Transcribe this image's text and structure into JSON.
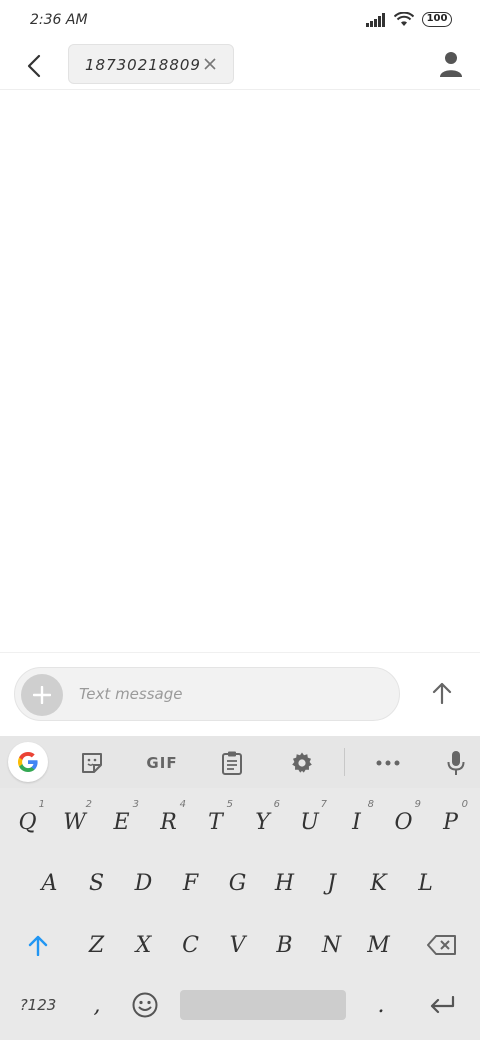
{
  "status_bar": {
    "time": "2:36 AM",
    "battery": "100"
  },
  "header": {
    "recipient": "18730218809",
    "back_icon": "back-chevron-icon",
    "close_icon": "close-icon",
    "contact_icon": "person-icon"
  },
  "compose": {
    "placeholder": "Text message",
    "value": "",
    "attach_icon": "plus-icon",
    "send_icon": "arrow-up-icon"
  },
  "keyboard": {
    "toolbar": {
      "gif_label": "GIF",
      "icons": [
        "google-icon",
        "sticker-icon",
        "gif-icon",
        "clipboard-icon",
        "gear-icon",
        "more-icon",
        "mic-icon"
      ]
    },
    "row1": [
      {
        "label": "Q",
        "hint": "1"
      },
      {
        "label": "W",
        "hint": "2"
      },
      {
        "label": "E",
        "hint": "3"
      },
      {
        "label": "R",
        "hint": "4"
      },
      {
        "label": "T",
        "hint": "5"
      },
      {
        "label": "Y",
        "hint": "6"
      },
      {
        "label": "U",
        "hint": "7"
      },
      {
        "label": "I",
        "hint": "8"
      },
      {
        "label": "O",
        "hint": "9"
      },
      {
        "label": "P",
        "hint": "0"
      }
    ],
    "row2": [
      "A",
      "S",
      "D",
      "F",
      "G",
      "H",
      "J",
      "K",
      "L"
    ],
    "row3": [
      "Z",
      "X",
      "C",
      "V",
      "B",
      "N",
      "M"
    ],
    "row4": {
      "symbols": "?123",
      "comma": ",",
      "period": "."
    },
    "colors": {
      "shift_accent": "#2196f3"
    }
  }
}
